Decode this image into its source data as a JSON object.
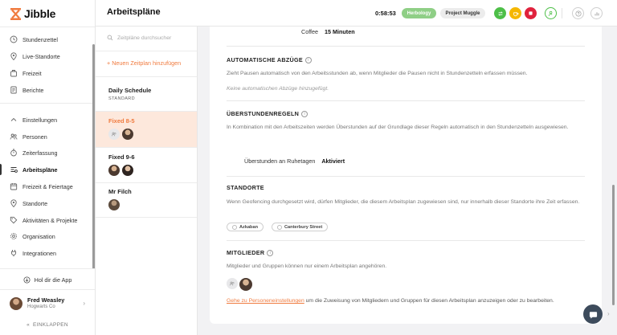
{
  "app": {
    "name": "Jibble",
    "brand_color": "#f07b3f"
  },
  "sidebar": {
    "items": [
      {
        "label": "Stundenzettel",
        "icon": "clock-icon"
      },
      {
        "label": "Live-Standorte",
        "icon": "map-pin-icon"
      },
      {
        "label": "Freizeit",
        "icon": "suitcase-icon"
      },
      {
        "label": "Berichte",
        "icon": "report-icon"
      }
    ],
    "settings_header": "Einstellungen",
    "settings_items": [
      {
        "label": "Personen",
        "icon": "people-icon"
      },
      {
        "label": "Zeiterfassung",
        "icon": "stopwatch-icon"
      },
      {
        "label": "Arbeitspläne",
        "icon": "schedule-icon",
        "active": true
      },
      {
        "label": "Freizeit & Feiertage",
        "icon": "calendar-icon"
      },
      {
        "label": "Standorte",
        "icon": "map-pin-icon"
      },
      {
        "label": "Aktivitäten & Projekte",
        "icon": "tag-icon"
      },
      {
        "label": "Organisation",
        "icon": "gear-icon"
      },
      {
        "label": "Integrationen",
        "icon": "plug-icon"
      }
    ],
    "app_button": "Hol dir die App",
    "user": {
      "name": "Fred Weasley",
      "org": "Hogwarts Co"
    },
    "collapse": "EINKLAPPEN"
  },
  "topbar": {
    "title": "Arbeitspläne",
    "timer": "0:58:53",
    "activity_pill": "Herbology",
    "project_pill": "Project Muggle"
  },
  "schedules": {
    "search_placeholder": "Zeitpläne durchsucher",
    "add_label": "+ Neuen Zeitplan hinzufügen",
    "items": [
      {
        "name": "Daily Schedule",
        "tag": "STANDARD"
      },
      {
        "name": "Fixed 8-5",
        "selected": true
      },
      {
        "name": "Fixed 9-6"
      },
      {
        "name": "Mr Filch"
      }
    ]
  },
  "detail": {
    "coffee_label": "Coffee",
    "coffee_value": "15 Minuten",
    "auto_deductions": {
      "title": "AUTOMATISCHE ABZÜGE",
      "text": "Zieht Pausen automatisch von den Arbeitsstunden ab, wenn Mitglieder die Pausen nicht in Stundenzetteln erfassen müssen.",
      "empty": "Keine automatischen Abzüge hinzugefügt."
    },
    "overtime": {
      "title": "ÜBERSTUNDENREGELN",
      "text": "In Kombination mit den Arbeitszeiten werden Überstunden auf der Grundlage dieser Regeln automatisch in den Stundenzetteln ausgewiesen.",
      "rule_label": "Überstunden an Ruhetagen",
      "rule_value": "Aktiviert"
    },
    "locations": {
      "title": "STANDORTE",
      "text": "Wenn Geofencing durchgesetzt wird, dürfen Mitglieder, die diesem Arbeitsplan zugewiesen sind, nur innerhalb dieser Standorte ihre Zeit erfassen.",
      "chips": [
        "Azkaban",
        "Canterbury Street"
      ]
    },
    "members": {
      "title": "MITGLIEDER",
      "text": "Mitglieder und Gruppen können nur einem Arbeitsplan angehören.",
      "link": "Gehe zu Personeneinstellungen",
      "link_suffix": " um die Zuweisung von Mitgliedern und Gruppen für diesen Arbeitsplan anzuzeigen oder zu bearbeiten."
    }
  }
}
